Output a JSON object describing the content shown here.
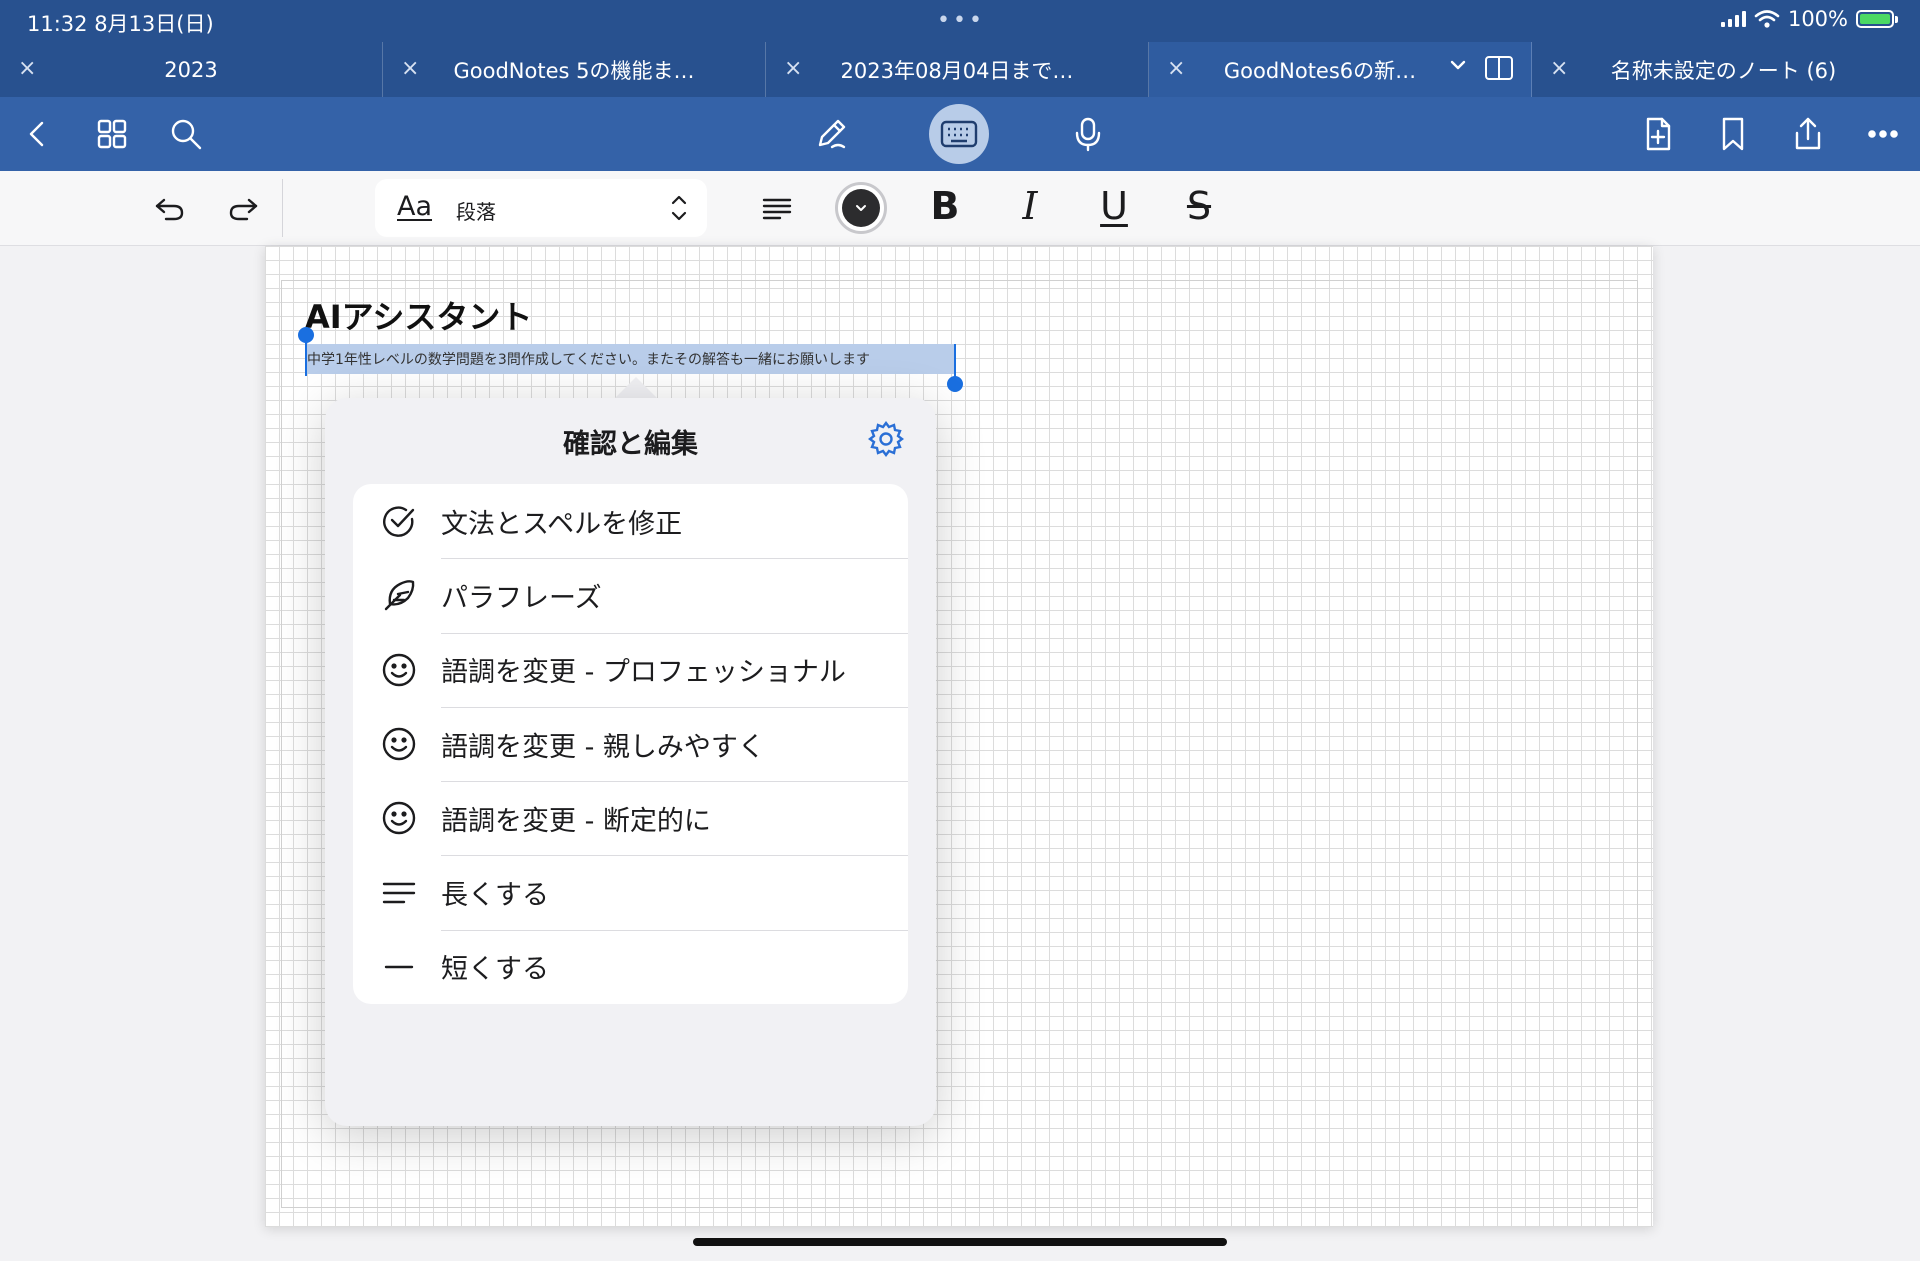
{
  "status_bar": {
    "time_date": "11:32   8月13日(日)",
    "battery": "100%",
    "multitask_dots": "•••"
  },
  "tabs": [
    {
      "label": "2023",
      "active": false
    },
    {
      "label": "GoodNotes 5の機能ま…",
      "active": false
    },
    {
      "label": "2023年08月04日まで…",
      "active": false
    },
    {
      "label": "GoodNotes6の新…",
      "active": true
    },
    {
      "label": "名称未設定のノート (6)",
      "active": false
    }
  ],
  "tab_close_glyph": "×",
  "toolbar": {
    "icons": [
      "back-icon",
      "grid-icon",
      "search-icon",
      "pen-icon",
      "keyboard-icon",
      "microphone-icon",
      "add-page-icon",
      "bookmark-icon",
      "share-icon",
      "more-icon"
    ]
  },
  "format_bar": {
    "style_aa": "Aa",
    "style_value": "段落",
    "bold": "B",
    "italic": "I",
    "underline": "U",
    "strikethrough": "S",
    "text_color": "#2c2c2e"
  },
  "note": {
    "title": "AIアシスタント",
    "selected_text": "中学1年性レベルの数学問題を3問作成してください。またその解答も一緒にお願いします"
  },
  "popover": {
    "title": "確認と編集",
    "items": [
      {
        "icon": "checkmark-circle-icon",
        "label": "文法とスペルを修正"
      },
      {
        "icon": "feather-icon",
        "label": "パラフレーズ"
      },
      {
        "icon": "smiley-icon",
        "label": "語調を変更 - プロフェッショナル"
      },
      {
        "icon": "smiley-icon",
        "label": "語調を変更 - 親しみやすく"
      },
      {
        "icon": "smiley-icon",
        "label": "語調を変更 - 断定的に"
      },
      {
        "icon": "lines-icon",
        "label": "長くする"
      },
      {
        "icon": "dash-icon",
        "label": "短くする"
      }
    ]
  },
  "colors": {
    "tab_bar": "#28518f",
    "toolbar": "#3462a8",
    "selection": "#b9cdea",
    "handle": "#1a6fe0",
    "gear": "#2a6fd6"
  }
}
